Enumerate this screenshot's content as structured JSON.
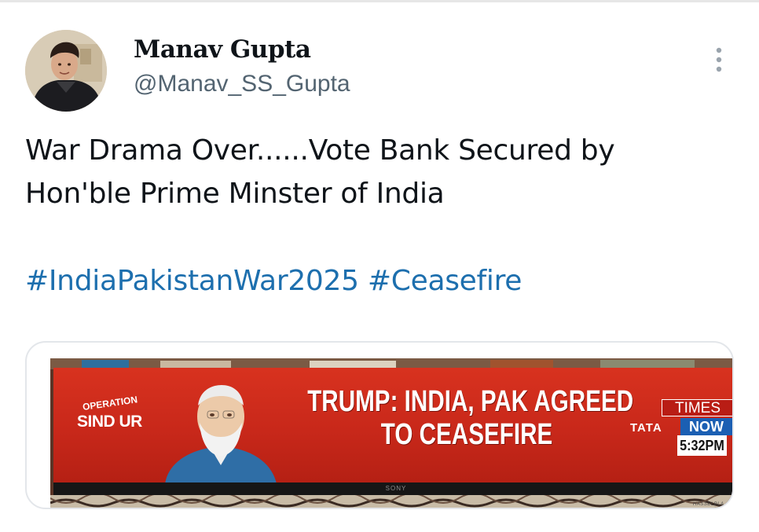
{
  "author": {
    "display_name": "Manav Gupta",
    "handle": "@Manav_SS_Gupta"
  },
  "tweet": {
    "text_lines": [
      "War Drama Over......Vote Bank Secured by",
      "Hon'ble Prime Minster of India"
    ],
    "hashtags": [
      "#IndiaPakistanWar2025",
      "#Ceasefire"
    ]
  },
  "media": {
    "headline_lines": [
      "TRUMP: INDIA, PAK AGREED",
      "TO CEASEFIRE"
    ],
    "program_logo": [
      "OPERATION",
      "SIND  UR"
    ],
    "channel": {
      "logo_top": "TIMES",
      "logo_bottom": "NOW",
      "sponsor": "TATA",
      "time": "5:32PM"
    },
    "tv_brand": "SONY",
    "watermark": "HASSELBLA"
  },
  "icons": {
    "more": "more-vertical-icon"
  },
  "colors": {
    "name": "#0f1419",
    "handle": "#536471",
    "hashtag": "#1d6fae",
    "headline_bg": "#d8321f",
    "channel_blue": "#1b5fb3"
  }
}
